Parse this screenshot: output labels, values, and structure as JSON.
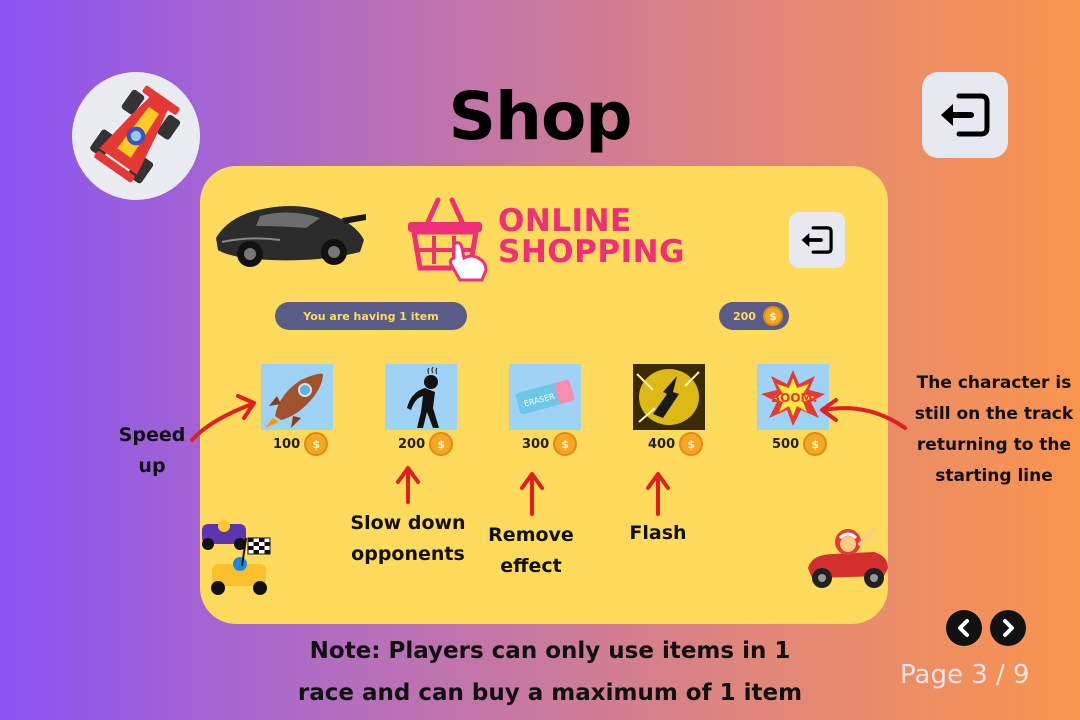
{
  "header": {
    "title": "Shop"
  },
  "shop": {
    "brand_line1": "ONLINE",
    "brand_line2": "SHOPPING",
    "item_count_text": "You are having 1 item",
    "coin_balance": "200",
    "items": [
      {
        "icon": "rocket-icon",
        "price": "100"
      },
      {
        "icon": "tired-person-icon",
        "price": "200"
      },
      {
        "icon": "eraser-icon",
        "price": "300"
      },
      {
        "icon": "flash-icon",
        "price": "400"
      },
      {
        "icon": "boom-icon",
        "price": "500"
      }
    ]
  },
  "annotations": {
    "speed_up": [
      "Speed",
      "up"
    ],
    "slow_down": [
      "Slow down",
      "opponents"
    ],
    "remove_effect": [
      "Remove",
      "effect"
    ],
    "flash": "Flash",
    "boom": [
      "The character is",
      "still on the track",
      "returning to the",
      "starting line"
    ]
  },
  "footer": {
    "note_line1": "Note: Players can only use items in 1",
    "note_line2": "race and can buy a maximum of 1 item",
    "page_text": "Page 3 / 9"
  },
  "colors": {
    "card": "#fedb5c",
    "brand_pink": "#ef2f77",
    "pill": "#595c86",
    "arrow_red": "#e02020"
  }
}
